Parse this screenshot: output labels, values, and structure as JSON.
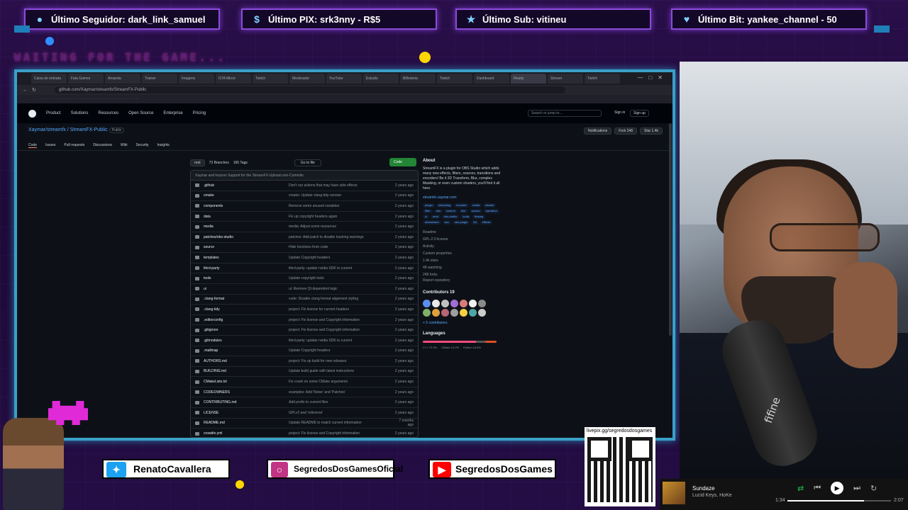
{
  "alerts": {
    "follower": "Último Seguidor: dark_link_samuel",
    "pix": "Último PIX: srk3nny - R$5",
    "sub": "Último Sub: vitineu",
    "bit": "Último Bit: yankee_channel - 50"
  },
  "waiting_text": "WAITING FOR THE GAME...",
  "browser": {
    "url": "github.com/Xaymar/streamfx/StreamFX-Public",
    "tabs": [
      "Caixa de entrada",
      "Fala Games",
      "Amanda",
      "Trainer",
      "Imagens",
      "GTA Mirror",
      "Twitch",
      "Moderador",
      "YouTube",
      "Estudio",
      "Bilheteria",
      "Twitch",
      "Dashboard",
      "Ready",
      "Stream",
      "Twitch"
    ],
    "active_tab_index": 13
  },
  "github": {
    "nav": [
      "Product",
      "Solutions",
      "Resources",
      "Open Source",
      "Enterprise",
      "Pricing"
    ],
    "search_placeholder": "Search or jump to...",
    "sign_in": "Sign in",
    "sign_up": "Sign up",
    "repo_owner": "Xaymar/streamfx",
    "repo_name": "StreamFX-Public",
    "repo_badge": "Public",
    "repo_buttons": [
      "Notifications",
      "Fork 248",
      "Star 1.4k"
    ],
    "repo_tabs": [
      "Code",
      "Issues",
      "Pull requests",
      "Discussions",
      "Wiki",
      "Security",
      "Insights"
    ],
    "branch": "root",
    "branches": "73 Branches",
    "tags": "165 Tags",
    "go_to_file": "Go to file",
    "code_button": "Code",
    "commit_message": "Xaymar and hoyoon Support for the StreamFX-Upload.com-Commits",
    "files": [
      {
        "name": ".github",
        "commit": "Don't run actions that may have side effects",
        "time": "2 years ago"
      },
      {
        "name": "cmake",
        "commit": "cmake: Update clang-tidy-version",
        "time": "2 years ago"
      },
      {
        "name": "components",
        "commit": "Remove some unused variables",
        "time": "2 years ago"
      },
      {
        "name": "data",
        "commit": "Fix up copyright headers again",
        "time": "2 years ago"
      },
      {
        "name": "media",
        "commit": "media: Adjust some resources",
        "time": "2 years ago"
      },
      {
        "name": "patches/obs-studio",
        "commit": "patches: Add patch to disable tracking warnings",
        "time": "2 years ago"
      },
      {
        "name": "source",
        "commit": "Hide functions from code",
        "time": "2 years ago"
      },
      {
        "name": "templates",
        "commit": "Update Copyright headers",
        "time": "2 years ago"
      },
      {
        "name": "third-party",
        "commit": "third-party: update nvidia SDK to current",
        "time": "2 years ago"
      },
      {
        "name": "tools",
        "commit": "Update copyright tools",
        "time": "2 years ago"
      },
      {
        "name": "ui",
        "commit": "ui: Remove Qt dependent logic",
        "time": "2 years ago"
      },
      {
        "name": ".clang-format",
        "commit": "code: Disable clang-format alignment styling",
        "time": "2 years ago"
      },
      {
        "name": ".clang-tidy",
        "commit": "project: Fix license for current headers",
        "time": "2 years ago"
      },
      {
        "name": ".editorconfig",
        "commit": "project: Fix license and Copyright information",
        "time": "2 years ago"
      },
      {
        "name": ".gitignore",
        "commit": "project: Fix license and Copyright information",
        "time": "2 years ago"
      },
      {
        "name": ".gitmodules",
        "commit": "third-party: update nvidia SDK to current",
        "time": "2 years ago"
      },
      {
        "name": ".mailmap",
        "commit": "Update Copyright headers",
        "time": "2 years ago"
      },
      {
        "name": "AUTHORS.md",
        "commit": "project: Fix up build for new releases",
        "time": "2 years ago"
      },
      {
        "name": "BUILDING.md",
        "commit": "Update build guide with latest instructions",
        "time": "2 years ago"
      },
      {
        "name": "CMakeLists.txt",
        "commit": "Fix crash on some CMake arguments",
        "time": "2 years ago"
      },
      {
        "name": "CODEOWNERS",
        "commit": "examples: Add 'Noise' and 'Patches'",
        "time": "2 years ago"
      },
      {
        "name": "CONTRIBUTING.md",
        "commit": "Add prefix to current files",
        "time": "2 years ago"
      },
      {
        "name": "LICENSE",
        "commit": "GPLv2 and 'relicense'",
        "time": "2 years ago"
      },
      {
        "name": "README.md",
        "commit": "Update README to match current information",
        "time": "7 months ago"
      },
      {
        "name": "crowdin.yml",
        "commit": "project: Fix license and Copyright information",
        "time": "2 years ago"
      }
    ],
    "about_title": "About",
    "about_desc": "StreamFX is a plugin for OBS Studio which adds many new effects, filters, sources, transitions and encoders! Be it 3D Transform, Blur, complex Masking, or even custom shaders, you'll find it all here.",
    "about_link": "streamfx.xaymar.com",
    "topics": [
      "plugin",
      "streaming",
      "encoder",
      "nvidia",
      "shader",
      "filter",
      "obs",
      "custom",
      "blur",
      "source",
      "transition",
      "ui",
      "amd",
      "obs-studio",
      "cuda",
      "ffmpeg",
      "streamlabs",
      "avc",
      "obs-plugin",
      "3d",
      "effects"
    ],
    "meta": [
      "Readme",
      "GPL-2.0 license",
      "Activity",
      "Custom properties",
      "1.4k stars",
      "48 watching",
      "248 forks"
    ],
    "report": "Report repository",
    "contributors_title": "Contributors",
    "contributors_count": "19",
    "contributors_more": "+ 5 contributors",
    "languages_title": "Languages",
    "languages": [
      "C++ 72.3%",
      "CMake 13.2%",
      "Python 14.5%"
    ]
  },
  "social": {
    "twitter": "RenatoCavallera",
    "instagram": "SegredosDosGamesOficial",
    "youtube": "SegredosDosGames"
  },
  "qr_url": "livepix.gg/segredosdosgames",
  "spotify": {
    "song": "Sundaze",
    "artist": "Lucid Keys, HoKe",
    "elapsed": "1:34",
    "duration": "2:07",
    "progress": 0.74
  },
  "webcam": {
    "mic_brand": "fifine"
  },
  "colors": {
    "frame_border": "#3aa0c8",
    "alert_border": "#8a4bd8",
    "github_green": "#238636",
    "twitter": "#1da1f2",
    "instagram": "#c13584",
    "youtube": "#ff0000"
  }
}
